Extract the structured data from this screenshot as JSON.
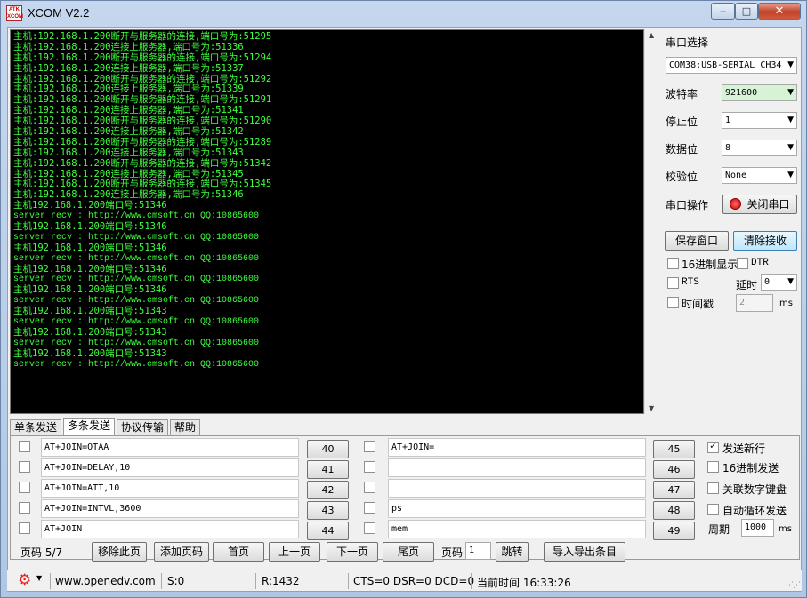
{
  "window": {
    "title": "XCOM V2.2",
    "logo_text": "ATK XCOM",
    "min": "‒",
    "max": "□",
    "close": "✕"
  },
  "terminal": {
    "lines": [
      "主机:192.168.1.200断开与服务器的连接,端口号为:51295",
      "主机:192.168.1.200连接上服务器,端口号为:51336",
      "主机:192.168.1.200断开与服务器的连接,端口号为:51294",
      "主机:192.168.1.200连接上服务器,端口号为:51337",
      "主机:192.168.1.200断开与服务器的连接,端口号为:51292",
      "主机:192.168.1.200连接上服务器,端口号为:51339",
      "主机:192.168.1.200断开与服务器的连接,端口号为:51291",
      "主机:192.168.1.200连接上服务器,端口号为:51341",
      "主机:192.168.1.200断开与服务器的连接,端口号为:51290",
      "主机:192.168.1.200连接上服务器,端口号为:51342",
      "主机:192.168.1.200断开与服务器的连接,端口号为:51289",
      "主机:192.168.1.200连接上服务器,端口号为:51343",
      "主机:192.168.1.200断开与服务器的连接,端口号为:51342",
      "主机:192.168.1.200连接上服务器,端口号为:51345",
      "主机:192.168.1.200断开与服务器的连接,端口号为:51345",
      "主机:192.168.1.200连接上服务器,端口号为:51346",
      "主机192.168.1.200端口号:51346",
      "server recv : http://www.cmsoft.cn QQ:10865600",
      "主机192.168.1.200端口号:51346",
      "server recv : http://www.cmsoft.cn QQ:10865600",
      "主机192.168.1.200端口号:51346",
      "server recv : http://www.cmsoft.cn QQ:10865600",
      "主机192.168.1.200端口号:51346",
      "server recv : http://www.cmsoft.cn QQ:10865600",
      "主机192.168.1.200端口号:51346",
      "server recv : http://www.cmsoft.cn QQ:10865600",
      "主机192.168.1.200端口号:51343",
      "server recv : http://www.cmsoft.cn QQ:10865600",
      "主机192.168.1.200端口号:51343",
      "server recv : http://www.cmsoft.cn QQ:10865600",
      "主机192.168.1.200端口号:51343",
      "server recv : http://www.cmsoft.cn QQ:10865600"
    ],
    "text_color": "#3fff3f"
  },
  "serial": {
    "port_label": "串口选择",
    "port_value": "COM38:USB-SERIAL CH34",
    "baud_label": "波特率",
    "baud_value": "921600",
    "stop_label": "停止位",
    "stop_value": "1",
    "data_label": "数据位",
    "data_value": "8",
    "parity_label": "校验位",
    "parity_value": "None",
    "op_label": "串口操作",
    "op_button": "关闭串口"
  },
  "actions": {
    "save_window": "保存窗口",
    "clear_recv": "清除接收"
  },
  "options": {
    "hex_display": "16进制显示",
    "dtr": "DTR",
    "rts": "RTS",
    "delay_label": "延时",
    "delay_value": "0",
    "timestamp": "时间戳",
    "timestamp_value": "2",
    "ms": "ms"
  },
  "tabs": [
    "单条发送",
    "多条发送",
    "协议传输",
    "帮助"
  ],
  "multi_send": {
    "left": [
      {
        "text": "AT+JOIN=OTAA",
        "button": "40"
      },
      {
        "text": "AT+JOIN=DELAY,10",
        "button": "41"
      },
      {
        "text": "AT+JOIN=ATT,10",
        "button": "42"
      },
      {
        "text": "AT+JOIN=INTVL,3600",
        "button": "43"
      },
      {
        "text": "AT+JOIN",
        "button": "44"
      }
    ],
    "right": [
      {
        "text": "AT+JOIN=",
        "button": "45"
      },
      {
        "text": "",
        "button": "46"
      },
      {
        "text": "",
        "button": "47"
      },
      {
        "text": "ps",
        "button": "48"
      },
      {
        "text": "mem",
        "button": "49"
      }
    ],
    "send_newline": "发送新行",
    "hex_send": "16进制发送",
    "numpad": "关联数字键盘",
    "auto_loop": "自动循环发送",
    "period_label": "周期",
    "period_value": "1000",
    "ms": "ms"
  },
  "pager": {
    "page_label": "页码 5/7",
    "remove": "移除此页",
    "add": "添加页码",
    "first": "首页",
    "prev": "上一页",
    "next": "下一页",
    "last": "尾页",
    "goto_label": "页码",
    "goto_value": "1",
    "jump": "跳转",
    "import_export": "导入导出条目"
  },
  "status": {
    "gear_icon": "gear-icon",
    "url": "www.openedv.com",
    "sent": "S:0",
    "recv": "R:1432",
    "lines": "CTS=0 DSR=0 DCD=0",
    "time": "当前时间 16:33:26"
  }
}
